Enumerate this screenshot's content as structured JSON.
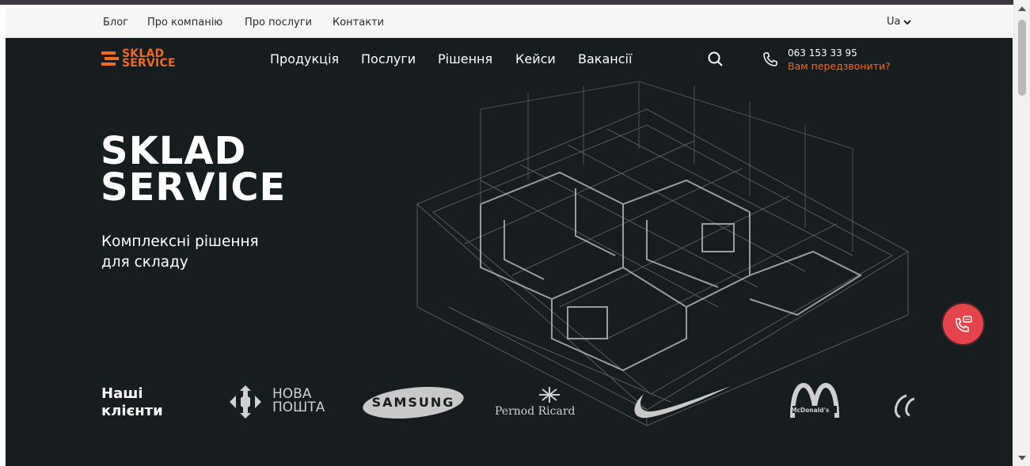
{
  "utility_bar": {
    "links": [
      "Блог",
      "Про компанію",
      "Про послуги",
      "Контакти"
    ],
    "language": "Ua"
  },
  "header": {
    "logo_line1": "SKLAD",
    "logo_line2": "SERVICE",
    "nav": [
      "Продукція",
      "Послуги",
      "Рішення",
      "Кейси",
      "Вакансії"
    ],
    "phone": "063 153 33 95",
    "callback": "Вам передзвонити?"
  },
  "hero": {
    "title_line1": "SKLAD",
    "title_line2": "SERVICE",
    "subtitle_line1": "Комплексні рішення",
    "subtitle_line2": "для складу"
  },
  "clients": {
    "title_line1": "Наші",
    "title_line2": "клієнти",
    "logos": [
      "НОВА ПОШТА",
      "SAMSUNG",
      "Pernod Ricard",
      "Nike",
      "McDonald's",
      "Coca-Cola"
    ],
    "nova_line1": "НОВА",
    "nova_line2": "ПОШТА",
    "samsung": "SAMSUNG",
    "pernod": "Pernod Ricard",
    "mcd": "McDonald's"
  },
  "colors": {
    "accent": "#f26a21",
    "background": "#171c1f",
    "fab": "#e5444a"
  }
}
